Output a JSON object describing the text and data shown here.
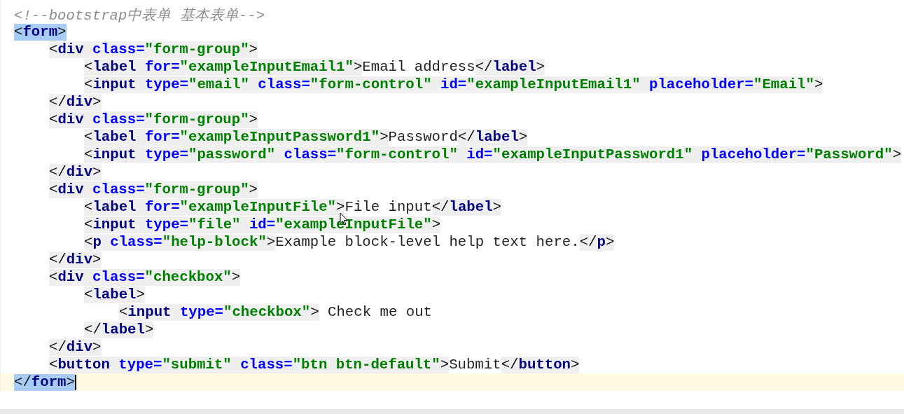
{
  "editor": {
    "lines": [
      {
        "current": false,
        "matched": false,
        "tokens": [
          {
            "kind": "comment",
            "text": "<!--bootstrap中表单 基本表单-->"
          }
        ]
      },
      {
        "current": false,
        "matched": true,
        "tokens": [
          {
            "kind": "punct",
            "text": "<"
          },
          {
            "kind": "tag",
            "text": "form"
          },
          {
            "kind": "punct",
            "text": ">"
          }
        ],
        "children": [
          {
            "current": false,
            "matched": false,
            "tokens": [
              {
                "kind": "punct",
                "text": "<"
              },
              {
                "kind": "tag",
                "text": "div"
              },
              {
                "kind": "attr",
                "text": " class="
              },
              {
                "kind": "value",
                "text": "\"form-group\""
              },
              {
                "kind": "punct",
                "text": ">"
              }
            ],
            "children": [
              {
                "current": false,
                "matched": false,
                "tokens": [
                  {
                    "kind": "punct",
                    "text": "<"
                  },
                  {
                    "kind": "tag",
                    "text": "label"
                  },
                  {
                    "kind": "attr",
                    "text": " for="
                  },
                  {
                    "kind": "value",
                    "text": "\"exampleInputEmail1\""
                  },
                  {
                    "kind": "punct",
                    "text": ">"
                  },
                  {
                    "kind": "text",
                    "text": "Email address"
                  },
                  {
                    "kind": "punct",
                    "text": "</"
                  },
                  {
                    "kind": "tag",
                    "text": "label"
                  },
                  {
                    "kind": "punct",
                    "text": ">"
                  }
                ]
              },
              {
                "current": false,
                "matched": false,
                "tokens": [
                  {
                    "kind": "punct",
                    "text": "<"
                  },
                  {
                    "kind": "tag",
                    "text": "input"
                  },
                  {
                    "kind": "attr",
                    "text": " type="
                  },
                  {
                    "kind": "value",
                    "text": "\"email\""
                  },
                  {
                    "kind": "attr",
                    "text": " class="
                  },
                  {
                    "kind": "value",
                    "text": "\"form-control\""
                  },
                  {
                    "kind": "attr",
                    "text": " id="
                  },
                  {
                    "kind": "value",
                    "text": "\"exampleInputEmail1\""
                  },
                  {
                    "kind": "attr",
                    "text": " placeholder="
                  },
                  {
                    "kind": "value",
                    "text": "\"Email\""
                  },
                  {
                    "kind": "punct",
                    "text": ">"
                  }
                ]
              }
            ]
          },
          {
            "current": false,
            "matched": false,
            "tokens": [
              {
                "kind": "punct",
                "text": "</"
              },
              {
                "kind": "tag",
                "text": "div"
              },
              {
                "kind": "punct",
                "text": ">"
              }
            ]
          },
          {
            "current": false,
            "matched": false,
            "tokens": [
              {
                "kind": "punct",
                "text": "<"
              },
              {
                "kind": "tag",
                "text": "div"
              },
              {
                "kind": "attr",
                "text": " class="
              },
              {
                "kind": "value",
                "text": "\"form-group\""
              },
              {
                "kind": "punct",
                "text": ">"
              }
            ],
            "children": [
              {
                "current": false,
                "matched": false,
                "tokens": [
                  {
                    "kind": "punct",
                    "text": "<"
                  },
                  {
                    "kind": "tag",
                    "text": "label"
                  },
                  {
                    "kind": "attr",
                    "text": " for="
                  },
                  {
                    "kind": "value",
                    "text": "\"exampleInputPassword1\""
                  },
                  {
                    "kind": "punct",
                    "text": ">"
                  },
                  {
                    "kind": "text",
                    "text": "Password"
                  },
                  {
                    "kind": "punct",
                    "text": "</"
                  },
                  {
                    "kind": "tag",
                    "text": "label"
                  },
                  {
                    "kind": "punct",
                    "text": ">"
                  }
                ]
              },
              {
                "current": false,
                "matched": false,
                "tokens": [
                  {
                    "kind": "punct",
                    "text": "<"
                  },
                  {
                    "kind": "tag",
                    "text": "input"
                  },
                  {
                    "kind": "attr",
                    "text": " type="
                  },
                  {
                    "kind": "value",
                    "text": "\"password\""
                  },
                  {
                    "kind": "attr",
                    "text": " class="
                  },
                  {
                    "kind": "value",
                    "text": "\"form-control\""
                  },
                  {
                    "kind": "attr",
                    "text": " id="
                  },
                  {
                    "kind": "value",
                    "text": "\"exampleInputPassword1\""
                  },
                  {
                    "kind": "attr",
                    "text": " placeholder="
                  },
                  {
                    "kind": "value",
                    "text": "\"Password\""
                  },
                  {
                    "kind": "punct",
                    "text": ">"
                  }
                ]
              }
            ]
          },
          {
            "current": false,
            "matched": false,
            "tokens": [
              {
                "kind": "punct",
                "text": "</"
              },
              {
                "kind": "tag",
                "text": "div"
              },
              {
                "kind": "punct",
                "text": ">"
              }
            ]
          },
          {
            "current": false,
            "matched": false,
            "tokens": [
              {
                "kind": "punct",
                "text": "<"
              },
              {
                "kind": "tag",
                "text": "div"
              },
              {
                "kind": "attr",
                "text": " class="
              },
              {
                "kind": "value",
                "text": "\"form-group\""
              },
              {
                "kind": "punct",
                "text": ">"
              }
            ],
            "children": [
              {
                "current": false,
                "matched": false,
                "tokens": [
                  {
                    "kind": "punct",
                    "text": "<"
                  },
                  {
                    "kind": "tag",
                    "text": "label"
                  },
                  {
                    "kind": "attr",
                    "text": " for="
                  },
                  {
                    "kind": "value",
                    "text": "\"exampleInputFile\""
                  },
                  {
                    "kind": "punct",
                    "text": ">"
                  },
                  {
                    "kind": "text",
                    "text": "File input"
                  },
                  {
                    "kind": "punct",
                    "text": "</"
                  },
                  {
                    "kind": "tag",
                    "text": "label"
                  },
                  {
                    "kind": "punct",
                    "text": ">"
                  }
                ]
              },
              {
                "current": false,
                "matched": false,
                "tokens": [
                  {
                    "kind": "punct",
                    "text": "<"
                  },
                  {
                    "kind": "tag",
                    "text": "input"
                  },
                  {
                    "kind": "attr",
                    "text": " type="
                  },
                  {
                    "kind": "value",
                    "text": "\"file\""
                  },
                  {
                    "kind": "attr",
                    "text": " id="
                  },
                  {
                    "kind": "value",
                    "text": "\"exampleInputFile\""
                  },
                  {
                    "kind": "punct",
                    "text": ">"
                  }
                ]
              },
              {
                "current": false,
                "matched": false,
                "tokens": [
                  {
                    "kind": "punct",
                    "text": "<"
                  },
                  {
                    "kind": "tag",
                    "text": "p"
                  },
                  {
                    "kind": "attr",
                    "text": " class="
                  },
                  {
                    "kind": "value",
                    "text": "\"help-block\""
                  },
                  {
                    "kind": "punct",
                    "text": ">"
                  },
                  {
                    "kind": "text",
                    "text": "Example block-level help text here."
                  },
                  {
                    "kind": "punct",
                    "text": "</"
                  },
                  {
                    "kind": "tag",
                    "text": "p"
                  },
                  {
                    "kind": "punct",
                    "text": ">"
                  }
                ]
              }
            ]
          },
          {
            "current": false,
            "matched": false,
            "tokens": [
              {
                "kind": "punct",
                "text": "</"
              },
              {
                "kind": "tag",
                "text": "div"
              },
              {
                "kind": "punct",
                "text": ">"
              }
            ]
          },
          {
            "current": false,
            "matched": false,
            "tokens": [
              {
                "kind": "punct",
                "text": "<"
              },
              {
                "kind": "tag",
                "text": "div"
              },
              {
                "kind": "attr",
                "text": " class="
              },
              {
                "kind": "value",
                "text": "\"checkbox\""
              },
              {
                "kind": "punct",
                "text": ">"
              }
            ],
            "children": [
              {
                "current": false,
                "matched": false,
                "tokens": [
                  {
                    "kind": "punct",
                    "text": "<"
                  },
                  {
                    "kind": "tag",
                    "text": "label"
                  },
                  {
                    "kind": "punct",
                    "text": ">"
                  }
                ],
                "children": [
                  {
                    "current": false,
                    "matched": false,
                    "tokens": [
                      {
                        "kind": "punct",
                        "text": "<"
                      },
                      {
                        "kind": "tag",
                        "text": "input"
                      },
                      {
                        "kind": "attr",
                        "text": " type="
                      },
                      {
                        "kind": "value",
                        "text": "\"checkbox\""
                      },
                      {
                        "kind": "punct",
                        "text": ">"
                      },
                      {
                        "kind": "text",
                        "text": " Check me out"
                      }
                    ]
                  }
                ]
              },
              {
                "current": false,
                "matched": false,
                "tokens": [
                  {
                    "kind": "punct",
                    "text": "</"
                  },
                  {
                    "kind": "tag",
                    "text": "label"
                  },
                  {
                    "kind": "punct",
                    "text": ">"
                  }
                ]
              }
            ]
          },
          {
            "current": false,
            "matched": false,
            "tokens": [
              {
                "kind": "punct",
                "text": "</"
              },
              {
                "kind": "tag",
                "text": "div"
              },
              {
                "kind": "punct",
                "text": ">"
              }
            ]
          },
          {
            "current": false,
            "matched": false,
            "tokens": [
              {
                "kind": "punct",
                "text": "<"
              },
              {
                "kind": "tag",
                "text": "button"
              },
              {
                "kind": "attr",
                "text": " type="
              },
              {
                "kind": "value",
                "text": "\"submit\""
              },
              {
                "kind": "attr",
                "text": " class="
              },
              {
                "kind": "value",
                "text": "\"btn btn-default\""
              },
              {
                "kind": "punct",
                "text": ">"
              },
              {
                "kind": "text",
                "text": "Submit"
              },
              {
                "kind": "punct",
                "text": "</"
              },
              {
                "kind": "tag",
                "text": "button"
              },
              {
                "kind": "punct",
                "text": ">"
              }
            ]
          }
        ]
      },
      {
        "current": true,
        "matched": true,
        "tokens": [
          {
            "kind": "punct",
            "text": "</"
          },
          {
            "kind": "tag",
            "text": "form"
          },
          {
            "kind": "punct",
            "text": ">"
          }
        ]
      }
    ]
  }
}
